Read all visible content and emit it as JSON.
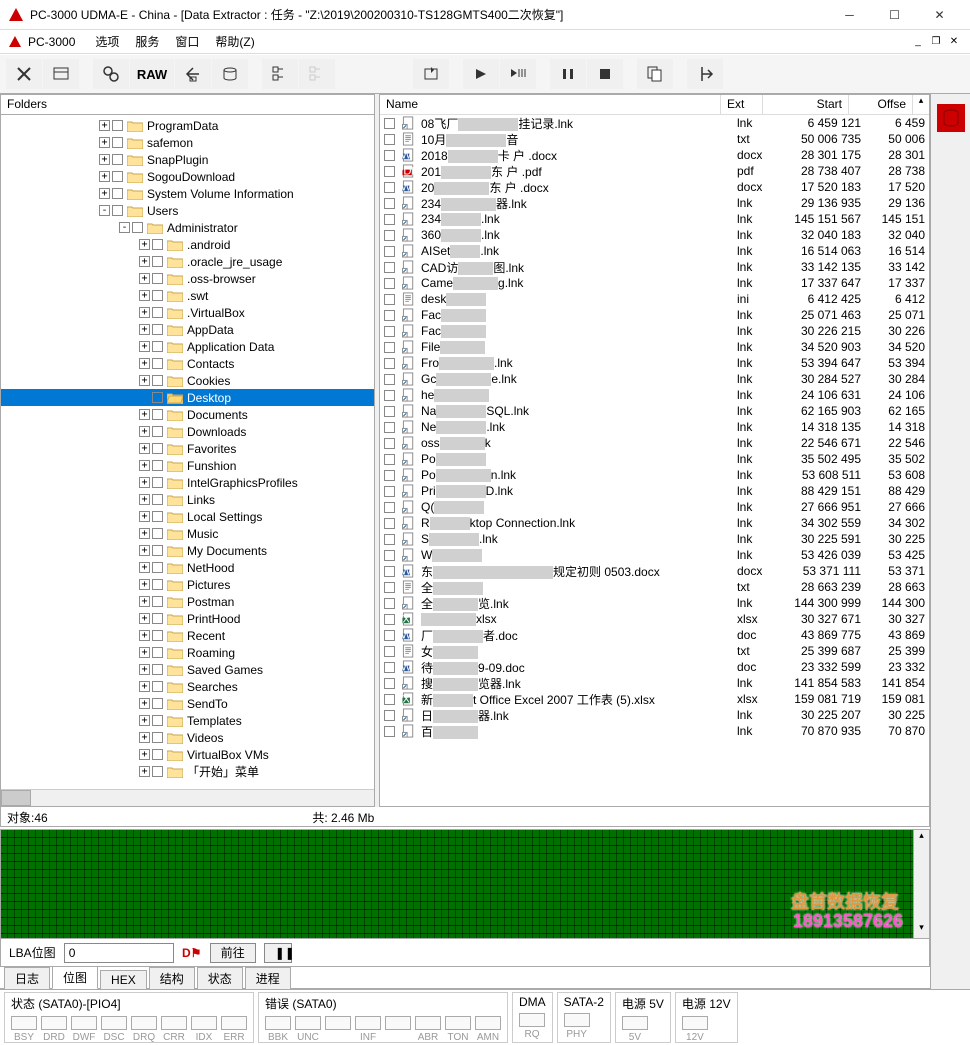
{
  "title": "PC-3000 UDMA-E - China - [Data Extractor : 任务 - \"Z:\\2019\\200200310-TS128GMTS400二次恢复\"]",
  "menubar": {
    "app": "PC-3000",
    "items": [
      "选项",
      "服务",
      "窗口",
      "帮助(Z)"
    ]
  },
  "toolbar": {
    "raw": "RAW"
  },
  "folders_label": "Folders",
  "tree": [
    {
      "indent": 0,
      "exp": "+",
      "name": "ProgramData"
    },
    {
      "indent": 0,
      "exp": "+",
      "name": "safemon"
    },
    {
      "indent": 0,
      "exp": "+",
      "name": "SnapPlugin"
    },
    {
      "indent": 0,
      "exp": "+",
      "name": "SogouDownload"
    },
    {
      "indent": 0,
      "exp": "+",
      "name": "System Volume Information"
    },
    {
      "indent": 0,
      "exp": "-",
      "name": "Users"
    },
    {
      "indent": 1,
      "exp": "-",
      "name": "Administrator"
    },
    {
      "indent": 2,
      "exp": "+",
      "name": ".android"
    },
    {
      "indent": 2,
      "exp": "+",
      "name": ".oracle_jre_usage"
    },
    {
      "indent": 2,
      "exp": "+",
      "name": ".oss-browser"
    },
    {
      "indent": 2,
      "exp": "+",
      "name": ".swt"
    },
    {
      "indent": 2,
      "exp": "+",
      "name": ".VirtualBox"
    },
    {
      "indent": 2,
      "exp": "+",
      "name": "AppData"
    },
    {
      "indent": 2,
      "exp": "+",
      "name": "Application Data"
    },
    {
      "indent": 2,
      "exp": "+",
      "name": "Contacts"
    },
    {
      "indent": 2,
      "exp": "+",
      "name": "Cookies"
    },
    {
      "indent": 2,
      "exp": " ",
      "name": "Desktop",
      "sel": true,
      "open": true
    },
    {
      "indent": 2,
      "exp": "+",
      "name": "Documents"
    },
    {
      "indent": 2,
      "exp": "+",
      "name": "Downloads"
    },
    {
      "indent": 2,
      "exp": "+",
      "name": "Favorites"
    },
    {
      "indent": 2,
      "exp": "+",
      "name": "Funshion"
    },
    {
      "indent": 2,
      "exp": "+",
      "name": "IntelGraphicsProfiles"
    },
    {
      "indent": 2,
      "exp": "+",
      "name": "Links"
    },
    {
      "indent": 2,
      "exp": "+",
      "name": "Local Settings"
    },
    {
      "indent": 2,
      "exp": "+",
      "name": "Music"
    },
    {
      "indent": 2,
      "exp": "+",
      "name": "My Documents"
    },
    {
      "indent": 2,
      "exp": "+",
      "name": "NetHood"
    },
    {
      "indent": 2,
      "exp": "+",
      "name": "Pictures"
    },
    {
      "indent": 2,
      "exp": "+",
      "name": "Postman"
    },
    {
      "indent": 2,
      "exp": "+",
      "name": "PrintHood"
    },
    {
      "indent": 2,
      "exp": "+",
      "name": "Recent"
    },
    {
      "indent": 2,
      "exp": "+",
      "name": "Roaming"
    },
    {
      "indent": 2,
      "exp": "+",
      "name": "Saved Games"
    },
    {
      "indent": 2,
      "exp": "+",
      "name": "Searches"
    },
    {
      "indent": 2,
      "exp": "+",
      "name": "SendTo"
    },
    {
      "indent": 2,
      "exp": "+",
      "name": "Templates"
    },
    {
      "indent": 2,
      "exp": "+",
      "name": "Videos"
    },
    {
      "indent": 2,
      "exp": "+",
      "name": "VirtualBox VMs"
    },
    {
      "indent": 2,
      "exp": "+",
      "name": "「开始」菜单"
    }
  ],
  "files_header": {
    "name": "Name",
    "ext": "Ext",
    "start": "Start",
    "offse": "Offse"
  },
  "files": [
    {
      "ic": "lnk",
      "pre": "08飞厂",
      "suf": "挂记录.lnk",
      "rw": 60,
      "ext": "lnk",
      "start": "6 459 121",
      "off": "6 459"
    },
    {
      "ic": "txt",
      "pre": "10月",
      "suf": "音",
      "rw": 60,
      "ext": "txt",
      "start": "50 006 735",
      "off": "50 006"
    },
    {
      "ic": "docx",
      "pre": "2018",
      "suf": "卡   户    .docx",
      "rw": 50,
      "ext": "docx",
      "start": "28 301 175",
      "off": "28 301"
    },
    {
      "ic": "pdf",
      "pre": "201",
      "suf": "东    户    .pdf",
      "rw": 50,
      "ext": "pdf",
      "start": "28 738 407",
      "off": "28 738"
    },
    {
      "ic": "docx",
      "pre": "20",
      "suf": "东    户    .docx",
      "rw": 55,
      "ext": "docx",
      "start": "17 520 183",
      "off": "17 520"
    },
    {
      "ic": "lnk",
      "pre": "234",
      "suf": "器.lnk",
      "rw": 55,
      "ext": "lnk",
      "start": "29 136 935",
      "off": "29 136"
    },
    {
      "ic": "lnk",
      "pre": "234",
      "suf": ".lnk",
      "rw": 40,
      "ext": "lnk",
      "start": "145 151 567",
      "off": "145 151"
    },
    {
      "ic": "lnk",
      "pre": "360",
      "suf": ".lnk",
      "rw": 40,
      "ext": "lnk",
      "start": "32 040 183",
      "off": "32 040"
    },
    {
      "ic": "lnk",
      "pre": "AISet",
      "suf": ".lnk",
      "rw": 30,
      "ext": "lnk",
      "start": "16 514 063",
      "off": "16 514"
    },
    {
      "ic": "lnk",
      "pre": "CAD访",
      "suf": "图.lnk",
      "rw": 35,
      "ext": "lnk",
      "start": "33 142 135",
      "off": "33 142"
    },
    {
      "ic": "lnk",
      "pre": "Came",
      "suf": "g.lnk",
      "rw": 45,
      "ext": "lnk",
      "start": "17 337 647",
      "off": "17 337"
    },
    {
      "ic": "ini",
      "pre": "desk",
      "suf": "",
      "rw": 40,
      "ext": "ini",
      "start": "6 412 425",
      "off": "6 412"
    },
    {
      "ic": "lnk",
      "pre": "Fac",
      "suf": "",
      "rw": 45,
      "ext": "lnk",
      "start": "25 071 463",
      "off": "25 071"
    },
    {
      "ic": "lnk",
      "pre": "Fac",
      "suf": "",
      "rw": 45,
      "ext": "lnk",
      "start": "30 226 215",
      "off": "30 226"
    },
    {
      "ic": "lnk",
      "pre": "File",
      "suf": "",
      "rw": 45,
      "ext": "lnk",
      "start": "34 520 903",
      "off": "34 520"
    },
    {
      "ic": "lnk",
      "pre": "Fro",
      "suf": ".lnk",
      "rw": 55,
      "ext": "lnk",
      "start": "53 394 647",
      "off": "53 394"
    },
    {
      "ic": "lnk",
      "pre": "Gc",
      "suf": "e.lnk",
      "rw": 55,
      "ext": "lnk",
      "start": "30 284 527",
      "off": "30 284"
    },
    {
      "ic": "lnk",
      "pre": "he",
      "suf": "",
      "rw": 55,
      "ext": "lnk",
      "start": "24 106 631",
      "off": "24 106"
    },
    {
      "ic": "lnk",
      "pre": "Na",
      "suf": "SQL.lnk",
      "rw": 50,
      "ext": "lnk",
      "start": "62 165 903",
      "off": "62 165"
    },
    {
      "ic": "lnk",
      "pre": "Ne",
      "suf": ".lnk",
      "rw": 50,
      "ext": "lnk",
      "start": "14 318 135",
      "off": "14 318"
    },
    {
      "ic": "lnk",
      "pre": "oss",
      "suf": "k",
      "rw": 45,
      "ext": "lnk",
      "start": "22 546 671",
      "off": "22 546"
    },
    {
      "ic": "lnk",
      "pre": "Po",
      "suf": "",
      "rw": 50,
      "ext": "lnk",
      "start": "35 502 495",
      "off": "35 502"
    },
    {
      "ic": "lnk",
      "pre": "Po",
      "suf": "n.lnk",
      "rw": 55,
      "ext": "lnk",
      "start": "53 608 511",
      "off": "53 608"
    },
    {
      "ic": "lnk",
      "pre": "Pri",
      "suf": "D.lnk",
      "rw": 50,
      "ext": "lnk",
      "start": "88 429 151",
      "off": "88 429"
    },
    {
      "ic": "lnk",
      "pre": "Q(",
      "suf": "",
      "rw": 50,
      "ext": "lnk",
      "start": "27 666 951",
      "off": "27 666"
    },
    {
      "ic": "lnk",
      "pre": "R",
      "suf": "ktop Connection.lnk",
      "rw": 40,
      "ext": "lnk",
      "start": "34 302 559",
      "off": "34 302"
    },
    {
      "ic": "lnk",
      "pre": "S",
      "suf": ".lnk",
      "rw": 50,
      "ext": "lnk",
      "start": "30 225 591",
      "off": "30 225"
    },
    {
      "ic": "lnk",
      "pre": "W",
      "suf": "",
      "rw": 50,
      "ext": "lnk",
      "start": "53 426 039",
      "off": "53 425"
    },
    {
      "ic": "docx",
      "pre": "东",
      "suf": "规定初则 0503.docx",
      "rw": 120,
      "ext": "docx",
      "start": "53 371 111",
      "off": "53 371"
    },
    {
      "ic": "txt",
      "pre": "全",
      "suf": "",
      "rw": 50,
      "ext": "txt",
      "start": "28 663 239",
      "off": "28 663"
    },
    {
      "ic": "lnk",
      "pre": "全",
      "suf": "览.lnk",
      "rw": 45,
      "ext": "lnk",
      "start": "144 300 999",
      "off": "144 300"
    },
    {
      "ic": "xlsx",
      "pre": "",
      "suf": "xlsx",
      "rw": 55,
      "ext": "xlsx",
      "start": "30 327 671",
      "off": "30 327"
    },
    {
      "ic": "doc",
      "pre": "厂",
      "suf": "者.doc",
      "rw": 50,
      "ext": "doc",
      "start": "43 869 775",
      "off": "43 869"
    },
    {
      "ic": "txt",
      "pre": "女",
      "suf": "",
      "rw": 45,
      "ext": "txt",
      "start": "25 399 687",
      "off": "25 399"
    },
    {
      "ic": "doc",
      "pre": "待",
      "suf": "9-09.doc",
      "rw": 45,
      "ext": "doc",
      "start": "23 332 599",
      "off": "23 332"
    },
    {
      "ic": "lnk",
      "pre": "搜",
      "suf": "览器.lnk",
      "rw": 45,
      "ext": "lnk",
      "start": "141 854 583",
      "off": "141 854"
    },
    {
      "ic": "xlsx",
      "pre": "新",
      "suf": "t Office Excel 2007 工作表 (5).xlsx",
      "rw": 40,
      "ext": "xlsx",
      "start": "159 081 719",
      "off": "159 081"
    },
    {
      "ic": "lnk",
      "pre": "日",
      "suf": "器.lnk",
      "rw": 45,
      "ext": "lnk",
      "start": "30 225 207",
      "off": "30 225"
    },
    {
      "ic": "lnk",
      "pre": "百",
      "suf": "",
      "rw": 45,
      "ext": "lnk",
      "start": "70 870 935",
      "off": "70 870"
    }
  ],
  "status": {
    "objects": "对象:46",
    "total": "共:  2.46 Mb"
  },
  "bitmap": {
    "label": "LBA位图",
    "value": "0",
    "go": "前往"
  },
  "phone": "18913587626",
  "watermark": "盘首数据恢复",
  "tabs": [
    "日志",
    "位图",
    "HEX",
    "结构",
    "状态",
    "进程"
  ],
  "tabs_active": 1,
  "statusbar": {
    "g1": {
      "title": "状态 (SATA0)-[PIO4]",
      "leds": [
        "BSY",
        "DRD",
        "DWF",
        "DSC",
        "DRQ",
        "CRR",
        "IDX",
        "ERR"
      ]
    },
    "g2": {
      "title": "错误 (SATA0)",
      "leds": [
        "BBK",
        "UNC",
        "",
        "INF",
        "",
        "ABR",
        "TON",
        "AMN"
      ]
    },
    "g3": {
      "title": "DMA",
      "leds": [
        "RQ"
      ]
    },
    "g4": {
      "title": "SATA-2",
      "leds": [
        "PHY"
      ]
    },
    "g5": {
      "title": "电源 5V",
      "leds": [
        "5V"
      ]
    },
    "g6": {
      "title": "电源 12V",
      "leds": [
        "12V"
      ]
    }
  }
}
